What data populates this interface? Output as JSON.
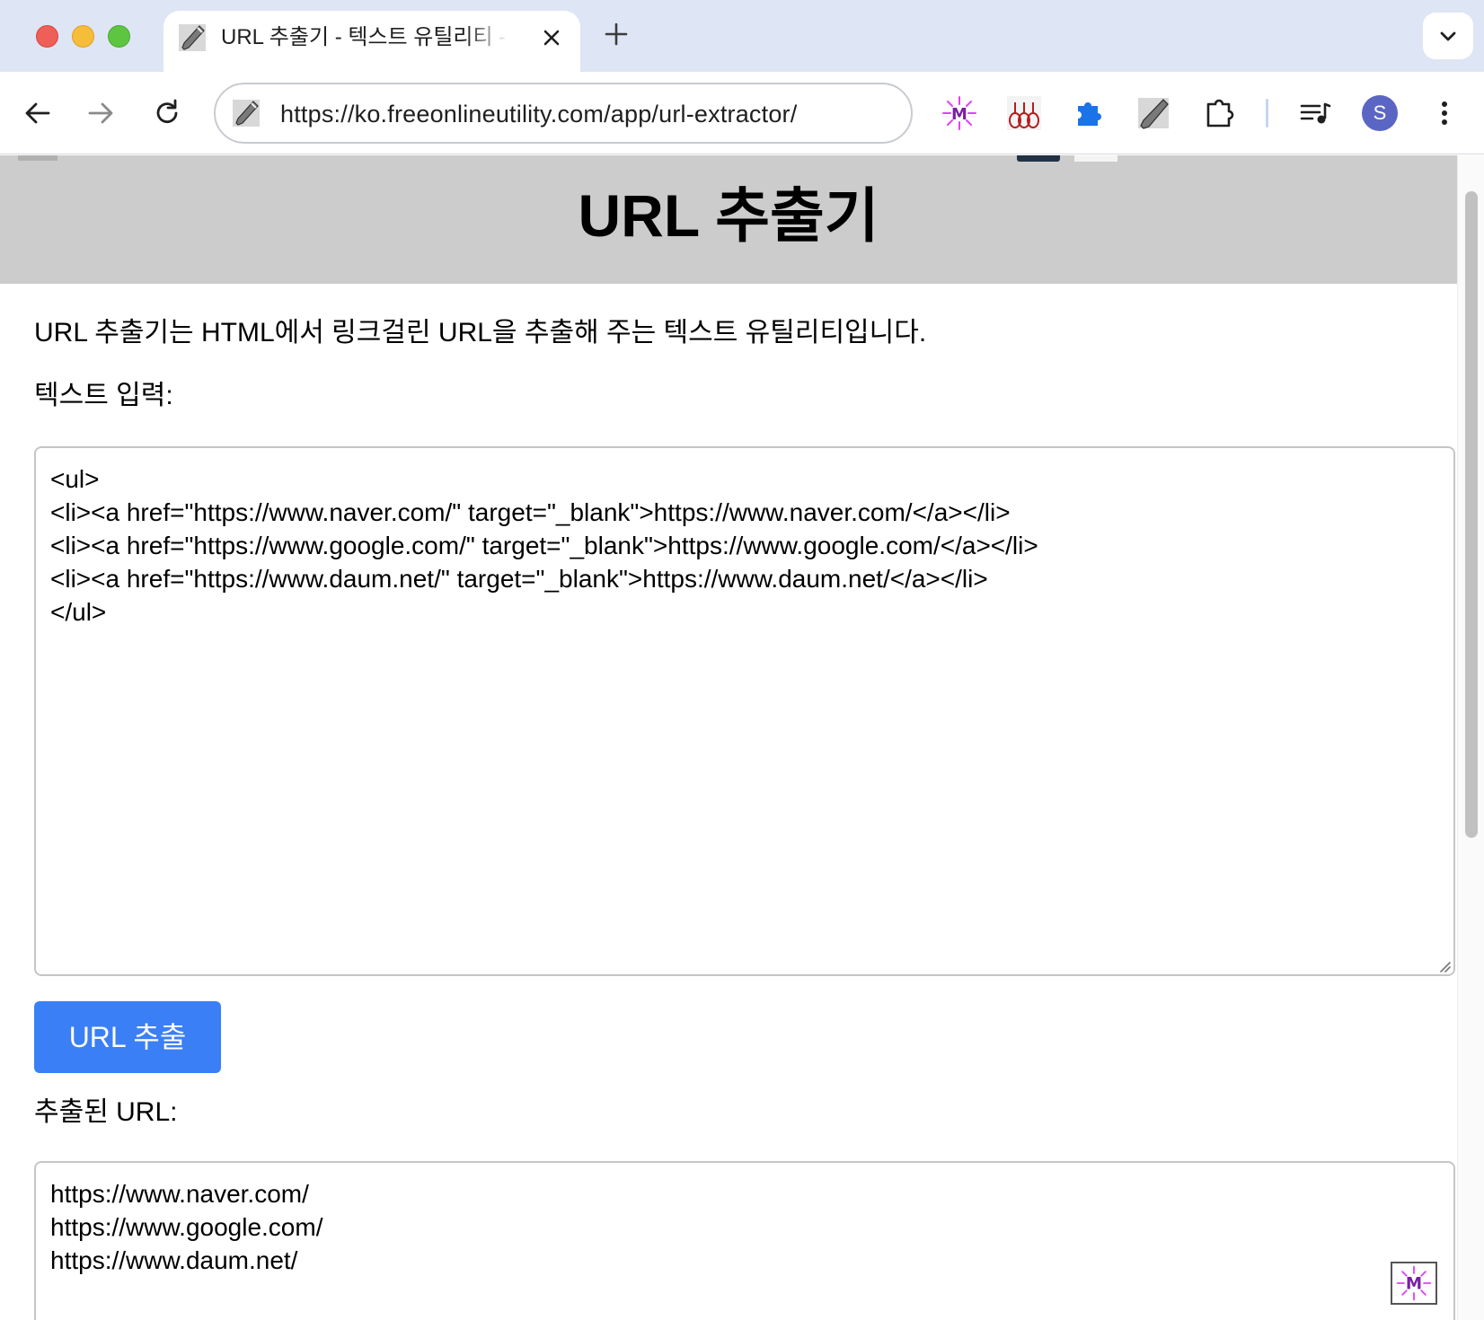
{
  "browser": {
    "tab_title": "URL 추출기 - 텍스트 유틸리티 - 무료 온라인 유틸리티",
    "address": "https://ko.freeonlineutility.com/app/url-extractor/",
    "profile_initial": "S"
  },
  "page": {
    "title": "URL 추출기",
    "description": "URL 추출기는 HTML에서 링크걸린 URL을 추출해 주는 텍스트 유틸리티입니다.",
    "input_label": "텍스트 입력:",
    "input_value": "<ul>\n<li><a href=\"https://www.naver.com/\" target=\"_blank\">https://www.naver.com/</a></li>\n<li><a href=\"https://www.google.com/\" target=\"_blank\">https://www.google.com/</a></li>\n<li><a href=\"https://www.daum.net/\" target=\"_blank\">https://www.daum.net/</a></li>\n</ul>",
    "extract_button": "URL 추출",
    "output_label": "추출된 URL:",
    "output_value": "https://www.naver.com/\nhttps://www.google.com/\nhttps://www.daum.net/"
  },
  "colors": {
    "accent": "#3a7ff5",
    "banner": "#cccccc",
    "tabstrip": "#dee5f5"
  }
}
